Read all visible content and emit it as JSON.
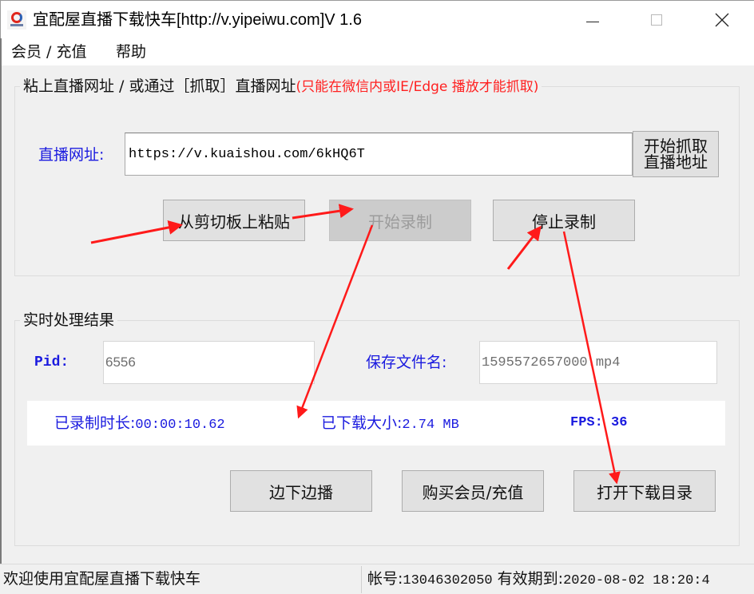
{
  "window": {
    "title": "宜配屋直播下载快车[http://v.yipeiwu.com]V 1.6",
    "icon": "app-logo-icon",
    "controls": {
      "minimize": "minimize-icon",
      "maximize": "maximize-icon",
      "close": "close-icon"
    }
  },
  "menu": {
    "items": [
      {
        "label": "会员 / 充值"
      },
      {
        "label": "帮助"
      }
    ]
  },
  "capture_group": {
    "legend": "粘上直播网址 / 或通过［抓取］直播网址",
    "legend_note": "(只能在微信内或IE/Edge 播放才能抓取)",
    "url_label": "直播网址:",
    "url_value": "https://v.kuaishou.com/6kHQ6T",
    "grab_button": {
      "line1": "开始抓取",
      "line2": "直播地址"
    },
    "paste_button": "从剪切板上粘贴",
    "start_button": "开始录制",
    "start_button_disabled": true,
    "stop_button": "停止录制"
  },
  "result_group": {
    "legend": "实时处理结果",
    "pid_label": "Pid:",
    "pid_value": "6556",
    "filename_label": "保存文件名:",
    "filename_value": "1595572657000.mp4",
    "duration_label": "已录制时长:",
    "duration_value": "00:00:10.62",
    "size_label": "已下载大小:",
    "size_value": "2.74 MB",
    "fps_label": "FPS:",
    "fps_value": "36",
    "bian_button": "边下边播",
    "buy_button": "购买会员/充值",
    "open_dir_button": "打开下载目录"
  },
  "statusbar": {
    "welcome": "欢迎使用宜配屋直播下载快车",
    "account_label": "帐号:",
    "account_value": "13046302050",
    "expiry_label": "有效期到:",
    "expiry_value": "2020-08-02 18:20:4"
  },
  "annotation": {
    "arrow_color": "#ff1a1a"
  },
  "colors": {
    "label_blue": "#1a1adf",
    "note_red": "#ff2020",
    "disabled_text": "#9c9c9c"
  }
}
